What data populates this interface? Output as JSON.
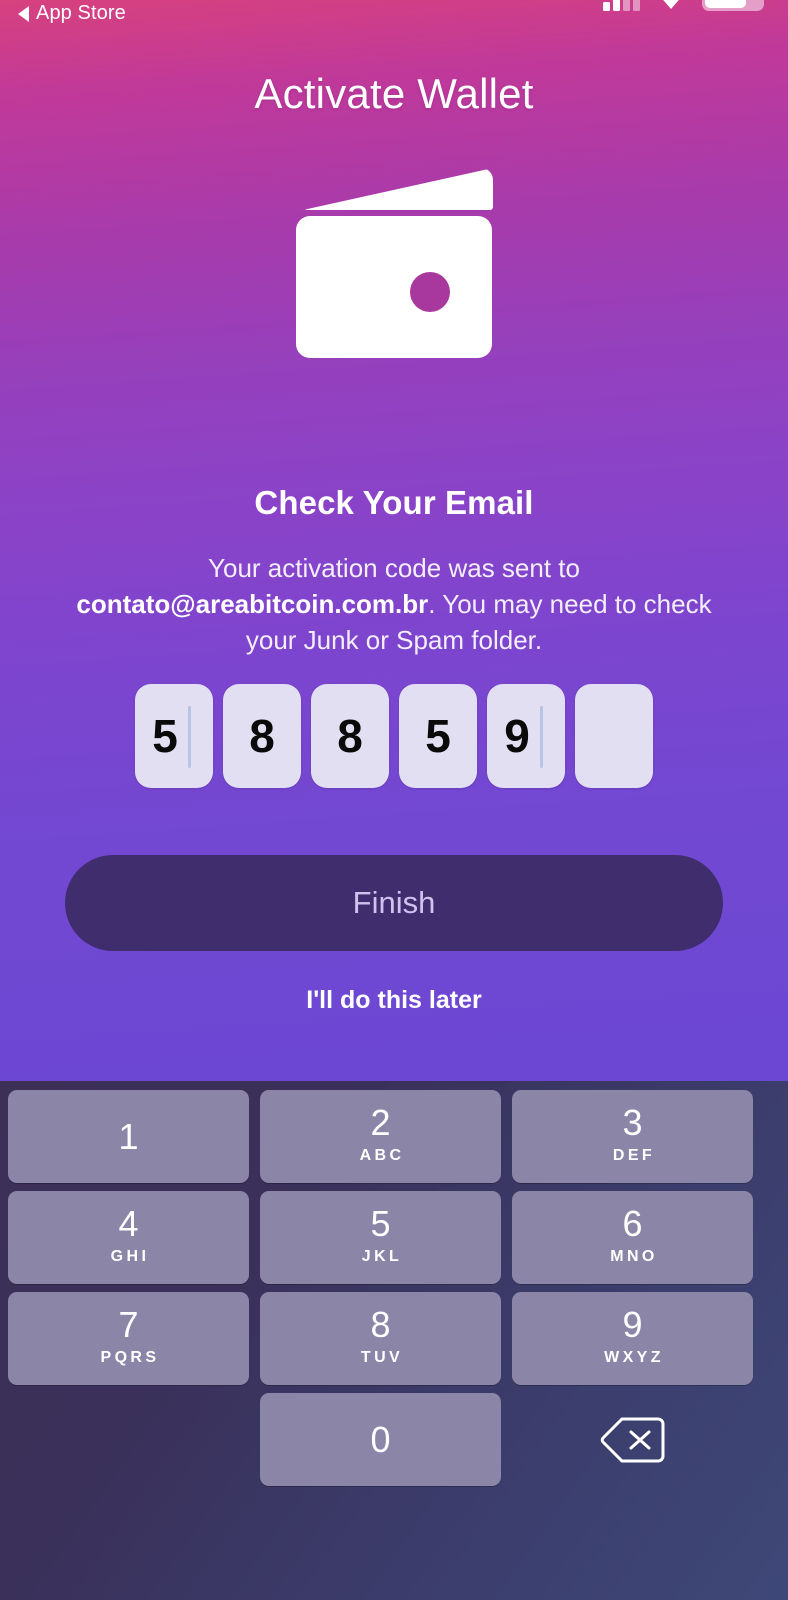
{
  "statusbar": {
    "back_label": "App Store",
    "back_icon": "back-triangle-icon",
    "signal_icon": "signal-bars-icon",
    "wifi_icon": "wifi-icon",
    "battery_icon": "battery-icon"
  },
  "header": {
    "title": "Activate Wallet"
  },
  "illustration": {
    "name": "wallet-icon",
    "body_color": "#ffffff",
    "clasp_color": "#a8389e"
  },
  "content": {
    "headline": "Check Your Email",
    "body_prefix": "Your activation code was sent to ",
    "body_email": "contato@areabitcoin.com.br",
    "body_suffix": ". You may need to check your Junk or Spam folder."
  },
  "otp": {
    "digits": [
      "5",
      "8",
      "8",
      "5",
      "9",
      ""
    ],
    "caret_index": 4,
    "box_color": "#e2dff2",
    "digit_color": "#0a0a0a"
  },
  "actions": {
    "primary_label": "Finish",
    "primary_bg": "#402d6e",
    "primary_text_color": "#cfc2ef",
    "secondary_label": "I'll do this later"
  },
  "keyboard": {
    "key_color": "#8b85a8",
    "background_color": "#3c3057",
    "keys": [
      {
        "num": "1",
        "letters": ""
      },
      {
        "num": "2",
        "letters": "ABC"
      },
      {
        "num": "3",
        "letters": "DEF"
      },
      {
        "num": "4",
        "letters": "GHI"
      },
      {
        "num": "5",
        "letters": "JKL"
      },
      {
        "num": "6",
        "letters": "MNO"
      },
      {
        "num": "7",
        "letters": "PQRS"
      },
      {
        "num": "8",
        "letters": "TUV"
      },
      {
        "num": "9",
        "letters": "WXYZ"
      },
      {
        "num": "0",
        "letters": ""
      }
    ],
    "backspace_icon": "backspace-icon"
  },
  "theme": {
    "gradient_top": "#d7417e",
    "gradient_mid": "#9540bd",
    "gradient_bottom": "#6b47d3"
  }
}
